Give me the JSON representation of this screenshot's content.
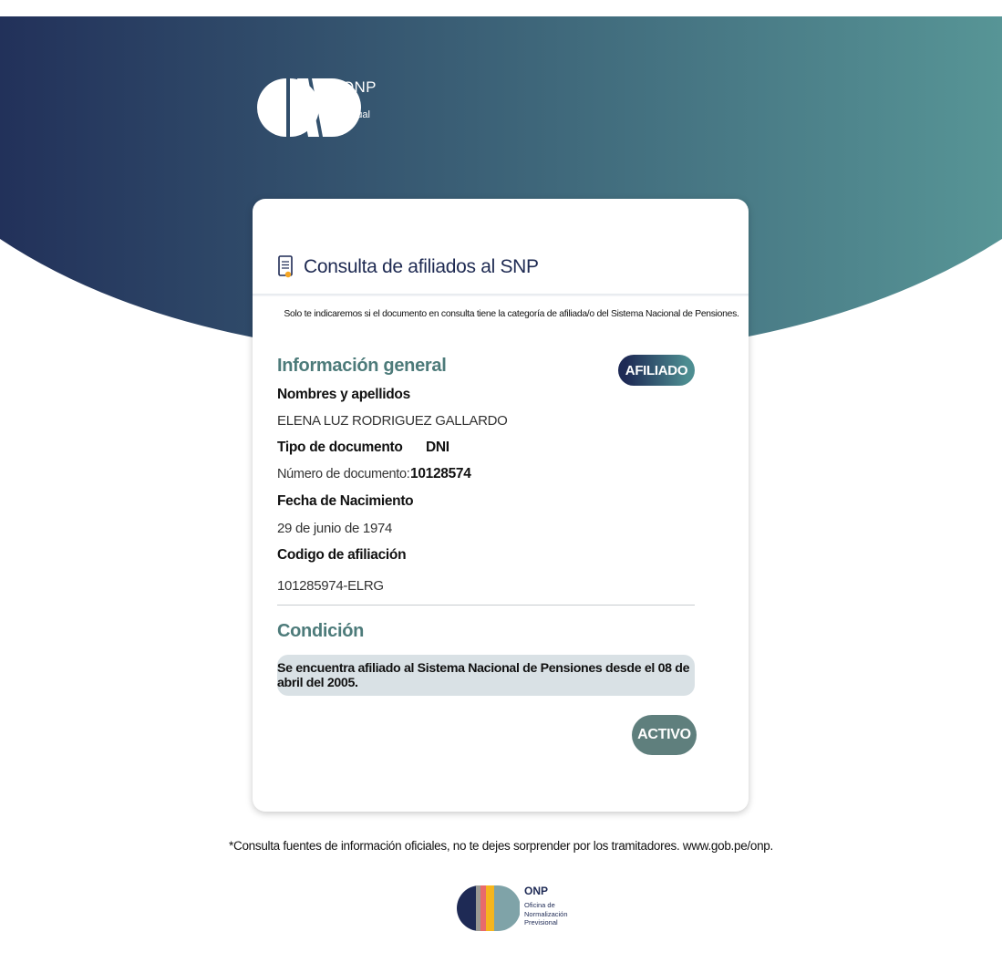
{
  "header": {
    "logo_name": "ONP",
    "logo_sub": "Virtual",
    "gradient": {
      "from": "#22315a",
      "to": "#579596"
    }
  },
  "card": {
    "icon": "document-icon",
    "title": "Consulta de afiliados al SNP",
    "subtitle": "Solo te indicaremos si el documento en consulta tiene la categoría de afiliada/o del Sistema Nacional de Pensiones.",
    "general": {
      "heading": "Información general",
      "status_badge": "AFILIADO",
      "names_label": "Nombres y apellidos",
      "names_value": "ELENA LUZ RODRIGUEZ GALLARDO",
      "doc_type_label": "Tipo de documento",
      "doc_type_value": "DNI",
      "doc_number_label": "Número de documento:",
      "doc_number_value": "10128574",
      "birth_label": "Fecha de Nacimiento",
      "birth_value": "29 de junio de 1974",
      "code_label": "Codigo de afiliación",
      "code_value": "101285974-ELRG"
    },
    "condition": {
      "heading": "Condición",
      "message": "Se encuentra afiliado al Sistema Nacional de Pensiones desde el 08 de abril del 2005.",
      "state_badge": "ACTIVO"
    }
  },
  "footer": {
    "note": "*Consulta fuentes de información oficiales, no te dejes sorprender por los tramitadores. www.gob.pe/onp.",
    "logo_name": "ONP",
    "org_line1": "Oficina de",
    "org_line2": "Normalización",
    "org_line3": "Previsional"
  },
  "colors": {
    "accent_teal": "#4d7b7a",
    "navy": "#1e2a55",
    "condition_bg": "#d9e1e5",
    "activo_bg": "#5f7f7d"
  }
}
